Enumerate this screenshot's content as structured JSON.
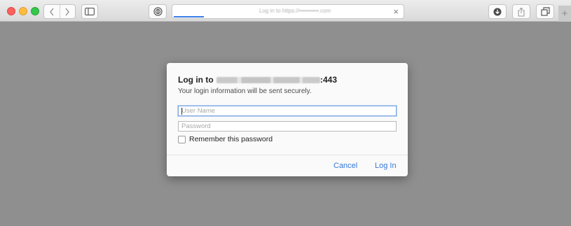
{
  "toolbar": {
    "address": {
      "url_text": "Log in to https://••••••••••.com",
      "close_glyph": "×"
    },
    "new_tab_glyph": "+"
  },
  "dialog": {
    "title_prefix": "Log in to ",
    "title_port": ":443",
    "subtitle": "Your login information will be sent securely.",
    "username": {
      "placeholder": "User Name",
      "value": ""
    },
    "password": {
      "placeholder": "Password",
      "value": ""
    },
    "remember_label": "Remember this password",
    "remember_checked": false,
    "cancel_label": "Cancel",
    "login_label": "Log In"
  },
  "colors": {
    "accent": "#3478d6",
    "page_overlay": "#8f8f8f",
    "traffic_red": "#fc605c",
    "traffic_yellow": "#fdbc40",
    "traffic_green": "#34c84a"
  }
}
